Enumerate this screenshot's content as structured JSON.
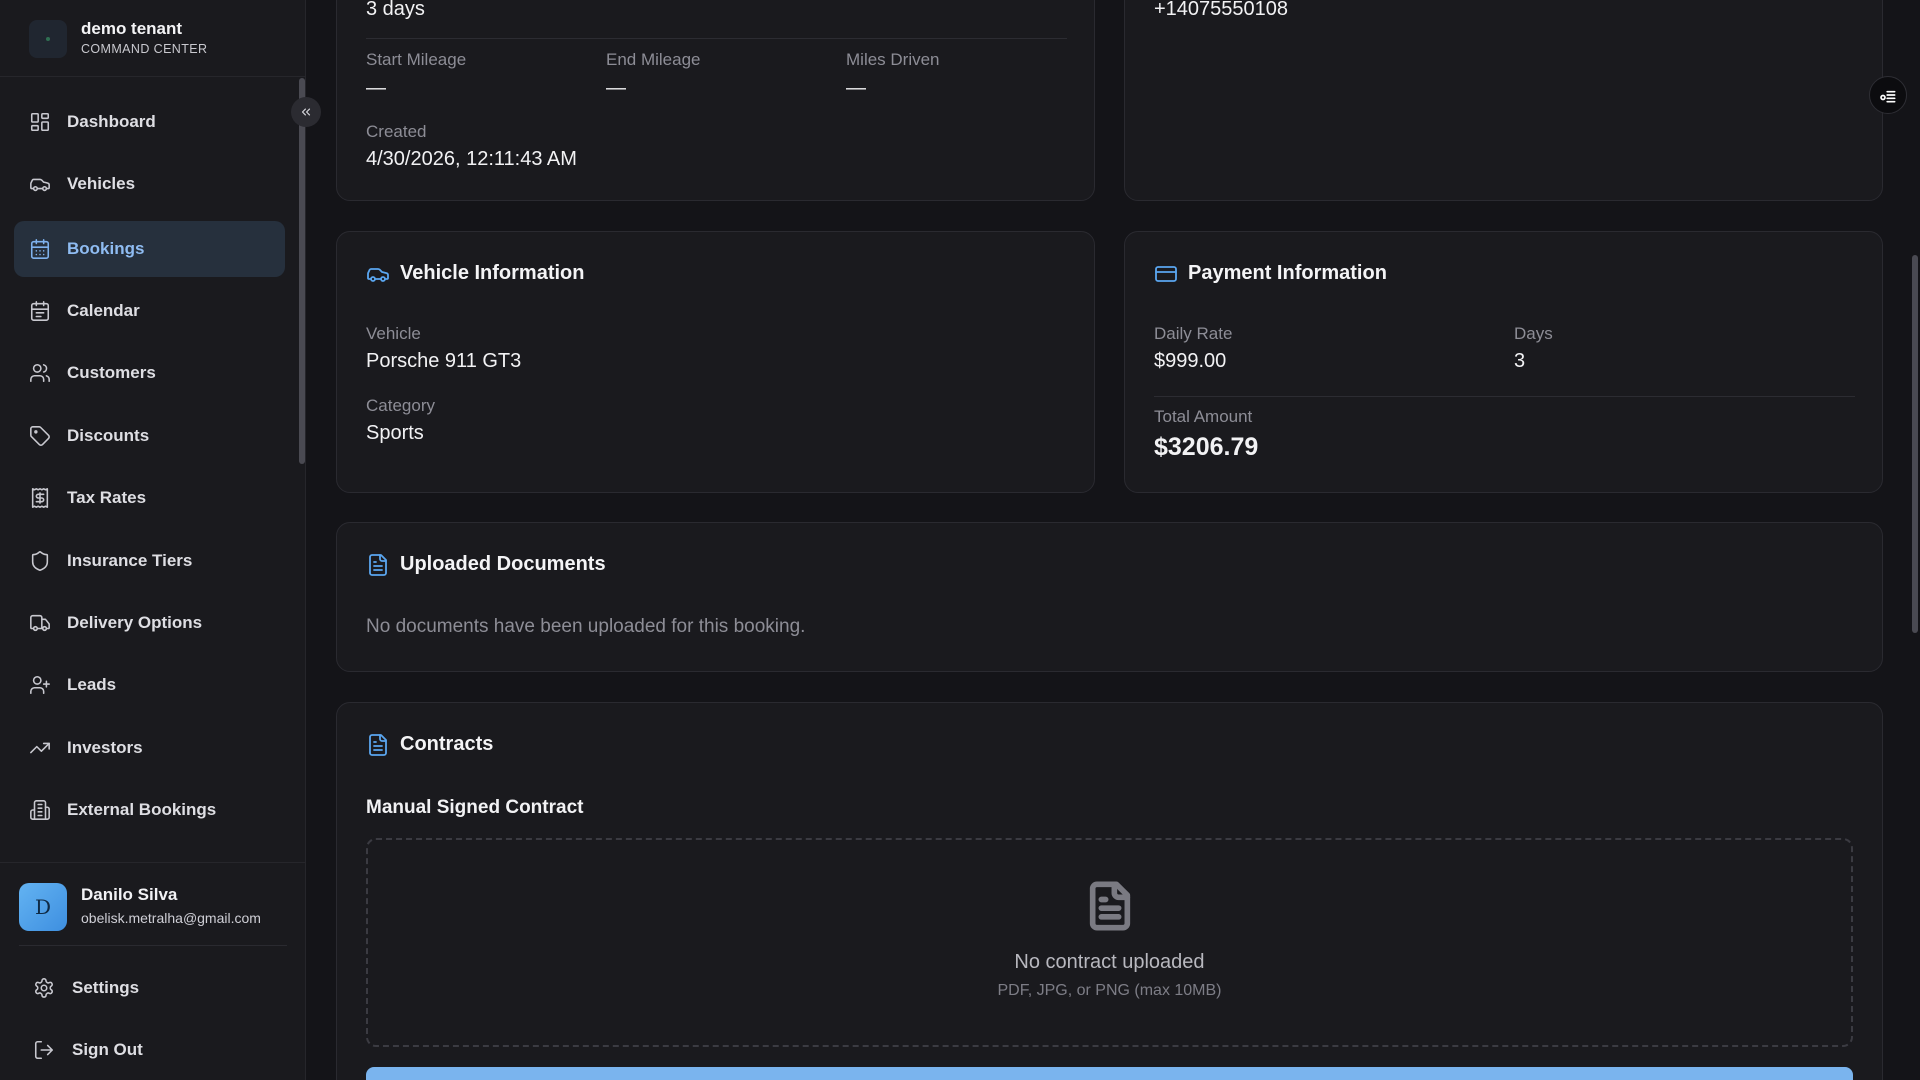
{
  "sidebar": {
    "tenant_name": "demo tenant",
    "tenant_subtitle": "COMMAND CENTER",
    "items": [
      {
        "label": "Dashboard",
        "icon": "dashboard-icon"
      },
      {
        "label": "Vehicles",
        "icon": "car-icon"
      },
      {
        "label": "Bookings",
        "icon": "calendar-grid-icon",
        "active": true
      },
      {
        "label": "Calendar",
        "icon": "calendar-icon"
      },
      {
        "label": "Customers",
        "icon": "users-icon"
      },
      {
        "label": "Discounts",
        "icon": "tag-icon"
      },
      {
        "label": "Tax Rates",
        "icon": "receipt-icon"
      },
      {
        "label": "Insurance Tiers",
        "icon": "shield-icon"
      },
      {
        "label": "Delivery Options",
        "icon": "truck-icon"
      },
      {
        "label": "Leads",
        "icon": "user-plus-icon"
      },
      {
        "label": "Investors",
        "icon": "trending-up-icon"
      },
      {
        "label": "External Bookings",
        "icon": "building-icon"
      }
    ],
    "user": {
      "initial": "D",
      "name": "Danilo Silva",
      "email": "obelisk.metralha@gmail.com"
    },
    "settings_label": "Settings",
    "signout_label": "Sign Out"
  },
  "booking_summary": {
    "duration": "3 days",
    "start_mileage_label": "Start Mileage",
    "start_mileage": "—",
    "end_mileage_label": "End Mileage",
    "end_mileage": "—",
    "miles_driven_label": "Miles Driven",
    "miles_driven": "—",
    "created_label": "Created",
    "created": "4/30/2026, 12:11:43 AM"
  },
  "customer": {
    "phone": "+14075550108"
  },
  "vehicle_info": {
    "title": "Vehicle Information",
    "vehicle_label": "Vehicle",
    "vehicle": "Porsche 911 GT3",
    "category_label": "Category",
    "category": "Sports"
  },
  "payment_info": {
    "title": "Payment Information",
    "daily_rate_label": "Daily Rate",
    "daily_rate": "$999.00",
    "days_label": "Days",
    "days": "3",
    "total_label": "Total Amount",
    "total": "$3206.79"
  },
  "documents": {
    "title": "Uploaded Documents",
    "empty_text": "No documents have been uploaded for this booking."
  },
  "contracts": {
    "title": "Contracts",
    "manual_title": "Manual Signed Contract",
    "empty_text": "No contract uploaded",
    "hint": "PDF, JPG, or PNG (max 10MB)"
  },
  "colors": {
    "accent": "#5aa6f0",
    "active_nav_bg": "#26303d",
    "background": "#141418",
    "card": "#1a1a1e"
  }
}
